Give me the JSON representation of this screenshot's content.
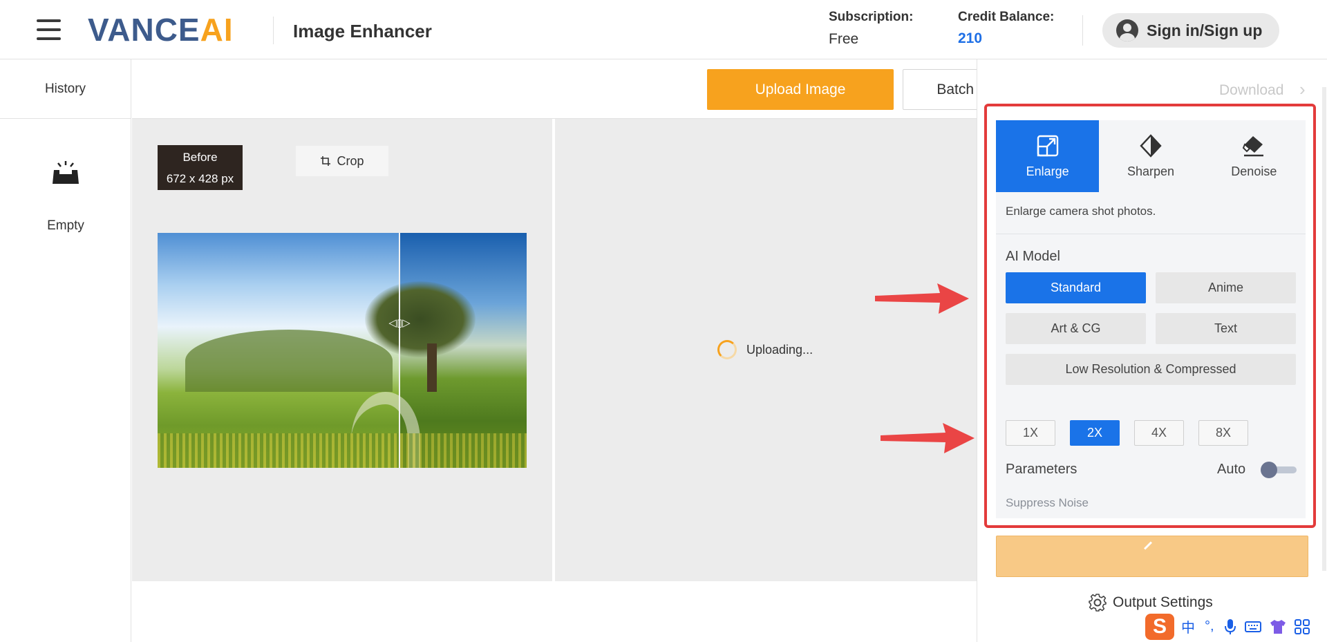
{
  "header": {
    "logo_part1": "VANCE",
    "logo_part2": "AI",
    "page_title": "Image Enhancer",
    "subscription_label": "Subscription:",
    "subscription_value": "Free",
    "credit_label": "Credit Balance:",
    "credit_value": "210",
    "signin_label": "Sign in/Sign up"
  },
  "sidebar": {
    "history_label": "History",
    "empty_label": "Empty"
  },
  "toolbar": {
    "upload_label": "Upload Image",
    "batch_label": "Batch Process ⟶"
  },
  "canvas": {
    "before_label": "Before",
    "before_size": "672 x 428 px",
    "crop_label": "Crop",
    "uploading_label": "Uploading..."
  },
  "panel": {
    "download_label": "Download",
    "tabs": [
      {
        "label": "Enlarge",
        "icon": "enlarge-icon",
        "active": true
      },
      {
        "label": "Sharpen",
        "icon": "sharpen-icon",
        "active": false
      },
      {
        "label": "Denoise",
        "icon": "eraser-icon",
        "active": false
      }
    ],
    "description": "Enlarge camera shot photos.",
    "ai_model_label": "AI Model",
    "models": {
      "standard": "Standard",
      "anime": "Anime",
      "art_cg": "Art & CG",
      "text": "Text",
      "low_res": "Low Resolution & Compressed"
    },
    "selected_model": "Standard",
    "scales": [
      "1X",
      "2X",
      "4X",
      "8X"
    ],
    "selected_scale": "2X",
    "parameters_label": "Parameters",
    "auto_label": "Auto",
    "auto_enabled": false,
    "suppress_noise_label": "Suppress Noise",
    "output_settings_label": "Output Settings"
  },
  "ime": {
    "logo": "S",
    "items": [
      "中",
      "°,"
    ]
  },
  "colors": {
    "accent_blue": "#1a73e8",
    "accent_orange": "#f7a21e",
    "highlight_red": "#e33b3b"
  }
}
